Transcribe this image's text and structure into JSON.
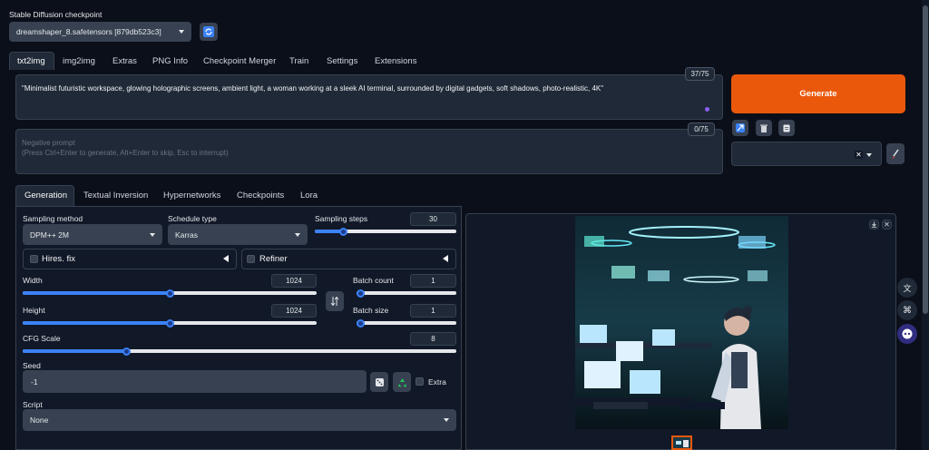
{
  "checkpoint": {
    "label": "Stable Diffusion checkpoint",
    "value": "dreamshaper_8.safetensors [879db523c3]"
  },
  "main_tabs": [
    "txt2img",
    "img2img",
    "Extras",
    "PNG Info",
    "Checkpoint Merger",
    "Train",
    "Settings",
    "Extensions"
  ],
  "prompt": {
    "text": "\"Minimalist futuristic workspace, glowing holographic screens, ambient light, a woman working at a sleek AI terminal, surrounded by digital gadgets, soft shadows, photo-realistic, 4K\"",
    "token_count": "37/75"
  },
  "negative_prompt": {
    "placeholder_line1": "Negative prompt",
    "placeholder_line2": "(Press Ctrl+Enter to generate, Alt+Enter to skip, Esc to interrupt)",
    "token_count": "0/75"
  },
  "generate_label": "Generate",
  "sub_tabs": [
    "Generation",
    "Textual Inversion",
    "Hypernetworks",
    "Checkpoints",
    "Lora"
  ],
  "sampling_method": {
    "label": "Sampling method",
    "value": "DPM++ 2M"
  },
  "schedule_type": {
    "label": "Schedule type",
    "value": "Karras"
  },
  "sampling_steps": {
    "label": "Sampling steps",
    "value": "30",
    "fraction": 0.2
  },
  "hires_fix": {
    "label": "Hires. fix"
  },
  "refiner": {
    "label": "Refiner"
  },
  "width": {
    "label": "Width",
    "value": "1024",
    "fraction": 0.5
  },
  "height": {
    "label": "Height",
    "value": "1024",
    "fraction": 0.5
  },
  "batch_count": {
    "label": "Batch count",
    "value": "1",
    "fraction": 0.0
  },
  "batch_size": {
    "label": "Batch size",
    "value": "1",
    "fraction": 0.0
  },
  "cfg_scale": {
    "label": "CFG Scale",
    "value": "8",
    "fraction": 0.24
  },
  "seed": {
    "label": "Seed",
    "value": "-1",
    "extra_label": "Extra"
  },
  "script": {
    "label": "Script",
    "value": "None"
  },
  "colors": {
    "generate": "#ea580c",
    "accent_blue": "#3b82f6",
    "background": "#0b0f19",
    "panel": "#1f2937"
  }
}
